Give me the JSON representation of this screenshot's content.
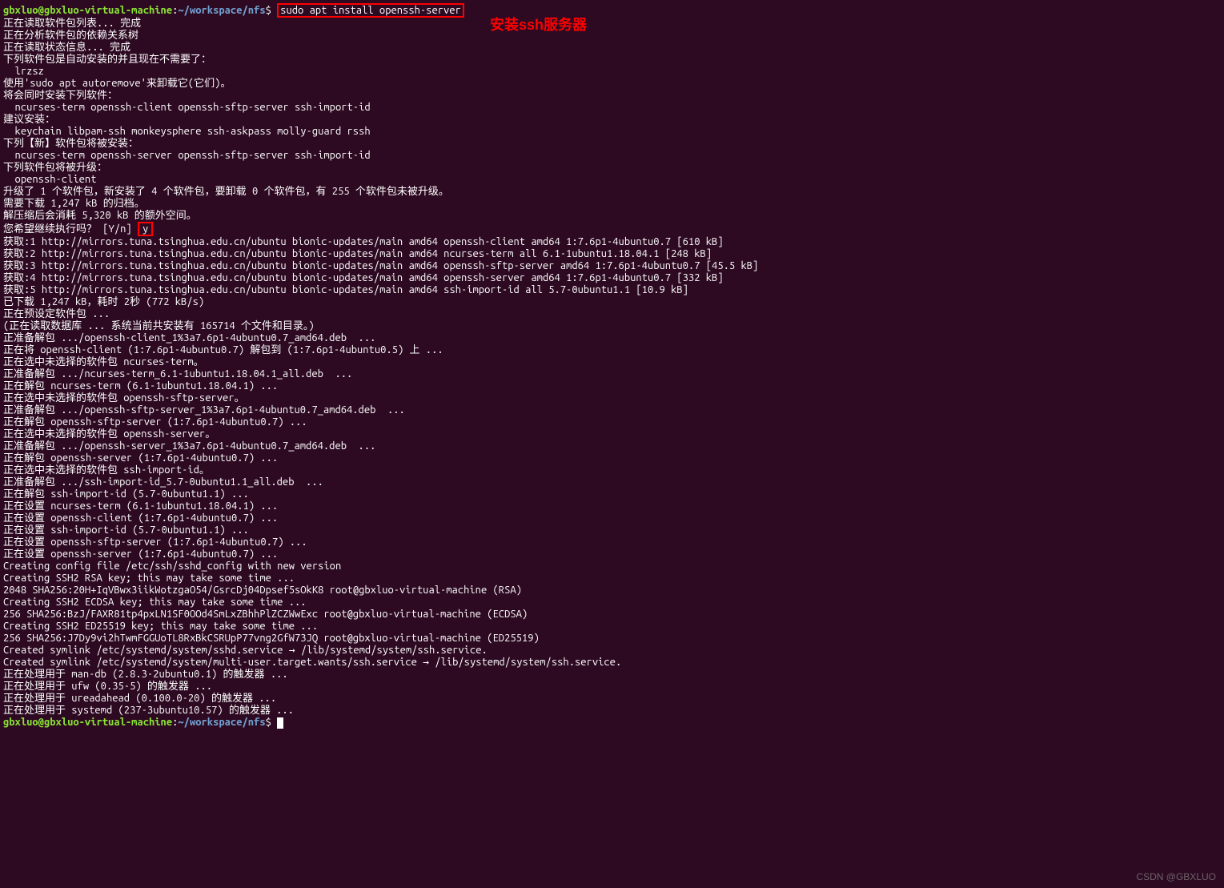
{
  "prompt": {
    "user": "gbxluo@gbxluo-virtual-machine",
    "separator": ":",
    "path": "~/workspace/nfs",
    "dollar": "$"
  },
  "command": "sudo apt install openssh-server",
  "annotation": "安装ssh服务器",
  "input_y": "y",
  "lines": [
    "正在读取软件包列表... 完成",
    "正在分析软件包的依赖关系树",
    "正在读取状态信息... 完成",
    "下列软件包是自动安装的并且现在不需要了：",
    "  lrzsz",
    "使用'sudo apt autoremove'来卸载它(它们)。",
    "将会同时安装下列软件：",
    "  ncurses-term openssh-client openssh-sftp-server ssh-import-id",
    "建议安装：",
    "  keychain libpam-ssh monkeysphere ssh-askpass molly-guard rssh",
    "下列【新】软件包将被安装：",
    "  ncurses-term openssh-server openssh-sftp-server ssh-import-id",
    "下列软件包将被升级：",
    "  openssh-client",
    "升级了 1 个软件包，新安装了 4 个软件包，要卸载 0 个软件包，有 255 个软件包未被升级。",
    "需要下载 1,247 kB 的归档。",
    "解压缩后会消耗 5,320 kB 的额外空间。"
  ],
  "confirm_prefix": "您希望继续执行吗？ [Y/n] ",
  "lines2": [
    "获取:1 http://mirrors.tuna.tsinghua.edu.cn/ubuntu bionic-updates/main amd64 openssh-client amd64 1:7.6p1-4ubuntu0.7 [610 kB]",
    "获取:2 http://mirrors.tuna.tsinghua.edu.cn/ubuntu bionic-updates/main amd64 ncurses-term all 6.1-1ubuntu1.18.04.1 [248 kB]",
    "获取:3 http://mirrors.tuna.tsinghua.edu.cn/ubuntu bionic-updates/main amd64 openssh-sftp-server amd64 1:7.6p1-4ubuntu0.7 [45.5 kB]",
    "获取:4 http://mirrors.tuna.tsinghua.edu.cn/ubuntu bionic-updates/main amd64 openssh-server amd64 1:7.6p1-4ubuntu0.7 [332 kB]",
    "获取:5 http://mirrors.tuna.tsinghua.edu.cn/ubuntu bionic-updates/main amd64 ssh-import-id all 5.7-0ubuntu1.1 [10.9 kB]",
    "已下载 1,247 kB，耗时 2秒 (772 kB/s)",
    "正在预设定软件包 ...",
    "(正在读取数据库 ... 系统当前共安装有 165714 个文件和目录。)",
    "正准备解包 .../openssh-client_1%3a7.6p1-4ubuntu0.7_amd64.deb  ...",
    "正在将 openssh-client (1:7.6p1-4ubuntu0.7) 解包到 (1:7.6p1-4ubuntu0.5) 上 ...",
    "正在选中未选择的软件包 ncurses-term。",
    "正准备解包 .../ncurses-term_6.1-1ubuntu1.18.04.1_all.deb  ...",
    "正在解包 ncurses-term (6.1-1ubuntu1.18.04.1) ...",
    "正在选中未选择的软件包 openssh-sftp-server。",
    "正准备解包 .../openssh-sftp-server_1%3a7.6p1-4ubuntu0.7_amd64.deb  ...",
    "正在解包 openssh-sftp-server (1:7.6p1-4ubuntu0.7) ...",
    "正在选中未选择的软件包 openssh-server。",
    "正准备解包 .../openssh-server_1%3a7.6p1-4ubuntu0.7_amd64.deb  ...",
    "正在解包 openssh-server (1:7.6p1-4ubuntu0.7) ...",
    "正在选中未选择的软件包 ssh-import-id。",
    "正准备解包 .../ssh-import-id_5.7-0ubuntu1.1_all.deb  ...",
    "正在解包 ssh-import-id (5.7-0ubuntu1.1) ...",
    "正在设置 ncurses-term (6.1-1ubuntu1.18.04.1) ...",
    "正在设置 openssh-client (1:7.6p1-4ubuntu0.7) ...",
    "正在设置 ssh-import-id (5.7-0ubuntu1.1) ...",
    "正在设置 openssh-sftp-server (1:7.6p1-4ubuntu0.7) ...",
    "正在设置 openssh-server (1:7.6p1-4ubuntu0.7) ...",
    "",
    "Creating config file /etc/ssh/sshd_config with new version",
    "Creating SSH2 RSA key; this may take some time ...",
    "2048 SHA256:20H+IqVBwx3iikWotzgaO54/GsrcDj04Dpsef5sOkK8 root@gbxluo-virtual-machine (RSA)",
    "Creating SSH2 ECDSA key; this may take some time ...",
    "256 SHA256:BzJ/FAXR81tp4pxLN1SF0OOd4SmLxZBhhPlZCZWwExc root@gbxluo-virtual-machine (ECDSA)",
    "Creating SSH2 ED25519 key; this may take some time ...",
    "256 SHA256:J7Dy9vi2hTwmFGGUoTL8RxBkCSRUpP77vng2GfW73JQ root@gbxluo-virtual-machine (ED25519)",
    "Created symlink /etc/systemd/system/sshd.service → /lib/systemd/system/ssh.service.",
    "Created symlink /etc/systemd/system/multi-user.target.wants/ssh.service → /lib/systemd/system/ssh.service.",
    "正在处理用于 man-db (2.8.3-2ubuntu0.1) 的触发器 ...",
    "正在处理用于 ufw (0.35-5) 的触发器 ...",
    "正在处理用于 ureadahead (0.100.0-20) 的触发器 ...",
    "正在处理用于 systemd (237-3ubuntu10.57) 的触发器 ..."
  ],
  "watermark": "CSDN @GBXLUO"
}
